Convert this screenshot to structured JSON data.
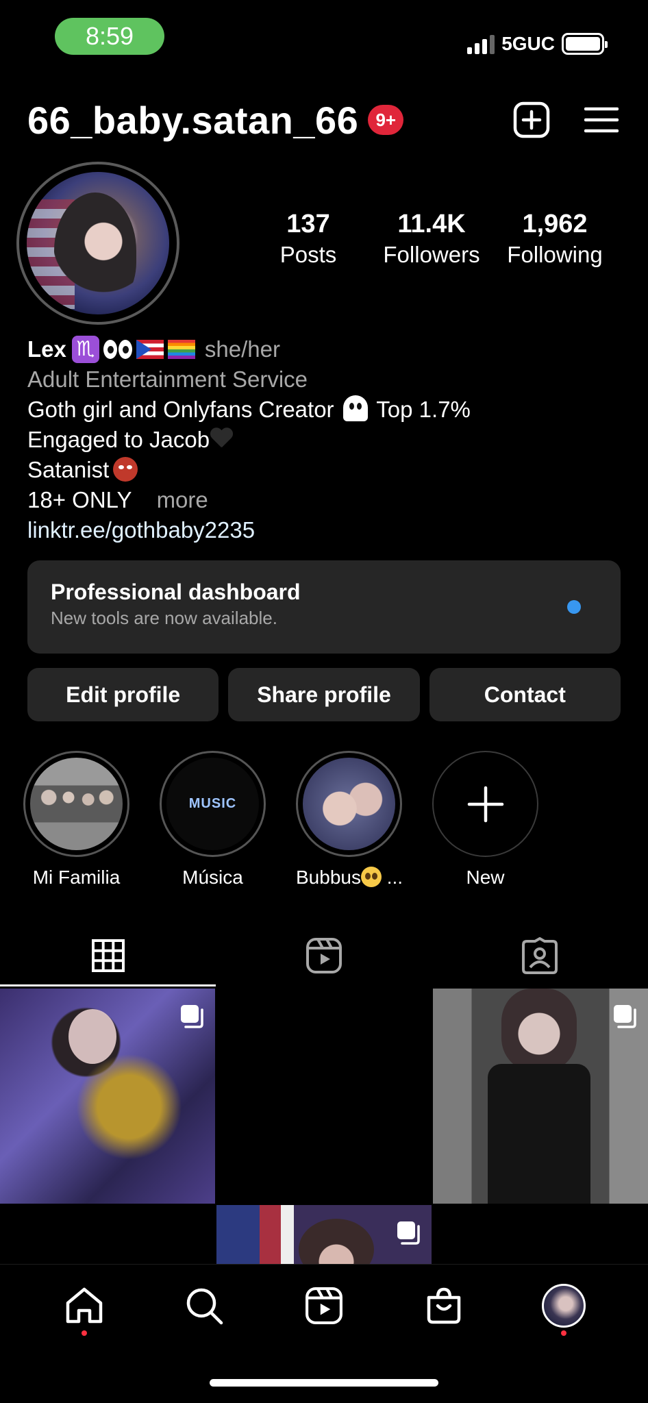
{
  "status_bar": {
    "time": "8:59",
    "network": "5GUC"
  },
  "header": {
    "username": "66_baby.satan_66",
    "notif_badge": "9+"
  },
  "profile": {
    "stats": [
      {
        "value": "137",
        "label": "Posts"
      },
      {
        "value": "11.4K",
        "label": "Followers"
      },
      {
        "value": "1,962",
        "label": "Following"
      }
    ]
  },
  "bio": {
    "name": "Lex",
    "pronouns": "she/her",
    "category": "Adult Entertainment Service",
    "line1": "Goth girl and Onlyfans Creator",
    "line1_tail": "Top 1.7%",
    "line2": "Engaged to Jacob",
    "line3": "Satanist",
    "line4": "18+ ONLY",
    "more": "more",
    "link": "linktr.ee/gothbaby2235"
  },
  "dashboard": {
    "title": "Professional dashboard",
    "subtitle": "New tools are now available."
  },
  "actions": {
    "edit": "Edit profile",
    "share": "Share profile",
    "contact": "Contact"
  },
  "highlights": [
    {
      "label": "Mi Familia"
    },
    {
      "label": "Música",
      "cover_text": "MUSIC"
    },
    {
      "label": "Bubbus",
      "suffix": "..."
    },
    {
      "label": "New"
    }
  ],
  "tabs": [
    "grid-icon",
    "reels-icon",
    "tagged-icon"
  ],
  "bottom_nav": [
    "home-icon",
    "search-icon",
    "reels-icon",
    "shop-icon",
    "profile-avatar"
  ],
  "colors": {
    "badge": "#e0263a",
    "status_pill": "#5fc35f",
    "dash_dot": "#3897f0",
    "nav_dot": "#ff3040",
    "card": "#262626"
  }
}
